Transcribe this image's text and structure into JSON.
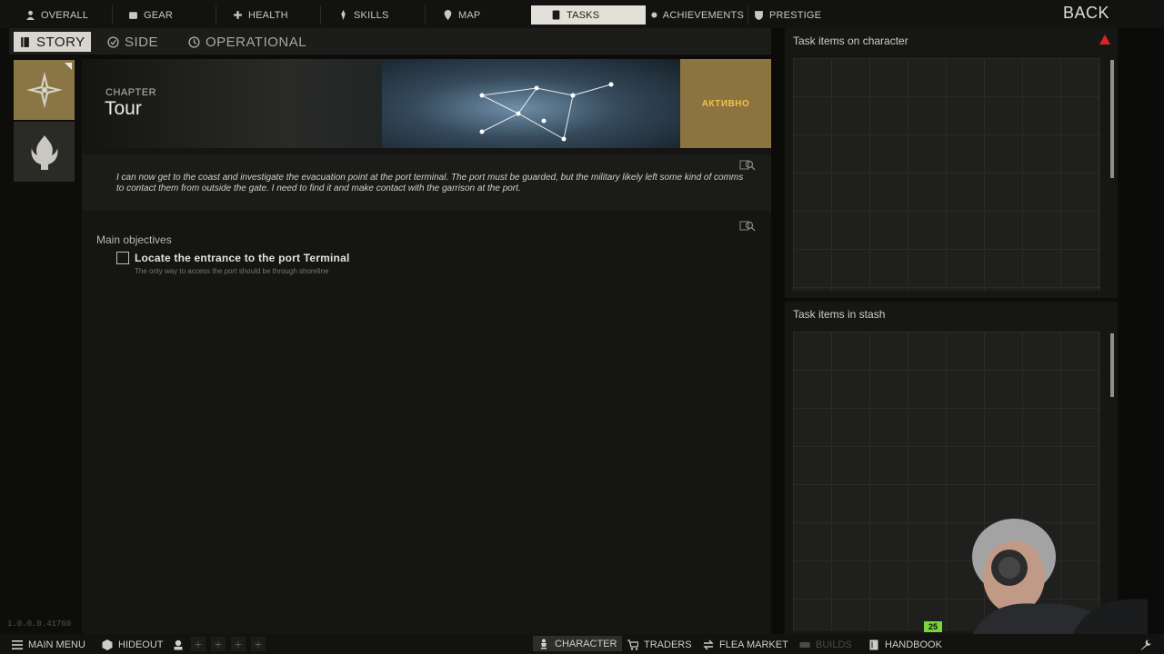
{
  "top_nav": {
    "tabs": [
      {
        "label": "OVERALL",
        "icon": "person-icon"
      },
      {
        "label": "GEAR",
        "icon": "gear-icon"
      },
      {
        "label": "HEALTH",
        "icon": "health-icon"
      },
      {
        "label": "SKILLS",
        "icon": "skills-icon"
      },
      {
        "label": "MAP",
        "icon": "map-pin-icon"
      },
      {
        "label": "TASKS",
        "icon": "tasks-icon",
        "active": true
      },
      {
        "label": "ACHIEVEMENTS",
        "icon": "achievements-icon"
      },
      {
        "label": "PRESTIGE",
        "icon": "prestige-icon"
      }
    ],
    "back_label": "BACK"
  },
  "categories": [
    {
      "label": "STORY",
      "icon": "book-icon",
      "active": true
    },
    {
      "label": "SIDE",
      "icon": "check-circle-icon"
    },
    {
      "label": "OPERATIONAL",
      "icon": "clock-icon"
    }
  ],
  "chapter": {
    "label": "CHAPTER",
    "title": "Tour",
    "status": "АКТИВНО",
    "description": "I can now get to the coast and investigate the evacuation point at the port terminal. The port must be guarded, but the military likely left some kind of comms to contact them from outside the gate. I need to find it and make contact with the garrison at the port."
  },
  "objectives": {
    "heading": "Main objectives",
    "items": [
      {
        "title": "Locate the entrance to the port Terminal",
        "hint": "The only way to access the port should be through shoreline",
        "checked": false
      }
    ]
  },
  "right_panels": {
    "character_title": "Task items on character",
    "stash_title": "Task items in stash"
  },
  "version": "1.0.0.0.41760",
  "bottom_bar": {
    "main_menu": "MAIN MENU",
    "hideout": "HIDEOUT",
    "character": "CHARACTER",
    "traders": "TRADERS",
    "flea_market": "FLEA MARKET",
    "builds": "BUILDS",
    "handbook": "HANDBOOK"
  },
  "webcam_badge": "25",
  "colors": {
    "accent_gold": "#8c7440",
    "status_text": "#f0c24a",
    "active_tab_bg": "#e2e0d8",
    "warning": "#dd2222"
  }
}
